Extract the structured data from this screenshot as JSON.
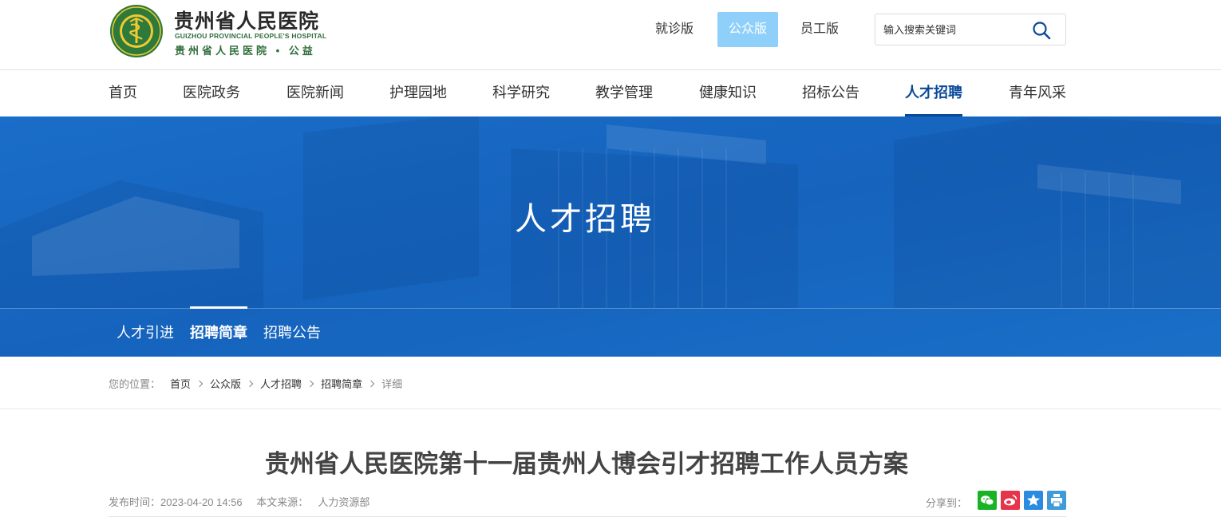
{
  "header": {
    "logo_cn": "贵州省人民医院",
    "logo_en": "GUIZHOU PROVINCIAL PEOPLE'S HOSPITAL",
    "logo_sub": "贵州省人民医院 • 公益",
    "versions": [
      {
        "label": "就诊版",
        "active": false
      },
      {
        "label": "公众版",
        "active": true
      },
      {
        "label": "员工版",
        "active": false
      }
    ],
    "search_placeholder": "输入搜索关键词"
  },
  "nav": {
    "items": [
      {
        "label": "首页"
      },
      {
        "label": "医院政务"
      },
      {
        "label": "医院新闻"
      },
      {
        "label": "护理园地"
      },
      {
        "label": "科学研究"
      },
      {
        "label": "教学管理"
      },
      {
        "label": "健康知识"
      },
      {
        "label": "招标公告"
      },
      {
        "label": "人才招聘",
        "active": true
      },
      {
        "label": "青年风采"
      }
    ]
  },
  "banner": {
    "title": "人才招聘",
    "subnav": [
      {
        "label": "人才引进",
        "active": false
      },
      {
        "label": "招聘简章",
        "active": true
      },
      {
        "label": "招聘公告",
        "active": false
      }
    ]
  },
  "breadcrumb": {
    "prefix": "您的位置：",
    "items": [
      "首页",
      "公众版",
      "人才招聘",
      "招聘简章"
    ],
    "current": "详细"
  },
  "article": {
    "title": "贵州省人民医院第十一届贵州人博会引才招聘工作人员方案",
    "publish_label": "发布时间：",
    "publish_time": "2023-04-20 14:56",
    "source_label": "本文来源：",
    "source": "人力资源部",
    "share_label": "分享到："
  },
  "colors": {
    "brand_blue": "#0b4a99",
    "banner_blue": "#1766c0",
    "active_version_bg": "#8fd0fa",
    "share_wechat": "#19b325",
    "share_weibo": "#e6344a",
    "share_favorite": "#2a8be0",
    "share_print": "#3f9ad8"
  },
  "icons": {
    "search": "search-icon",
    "wechat": "wechat-icon",
    "weibo": "weibo-icon",
    "favorite": "star-icon",
    "print": "print-icon"
  }
}
